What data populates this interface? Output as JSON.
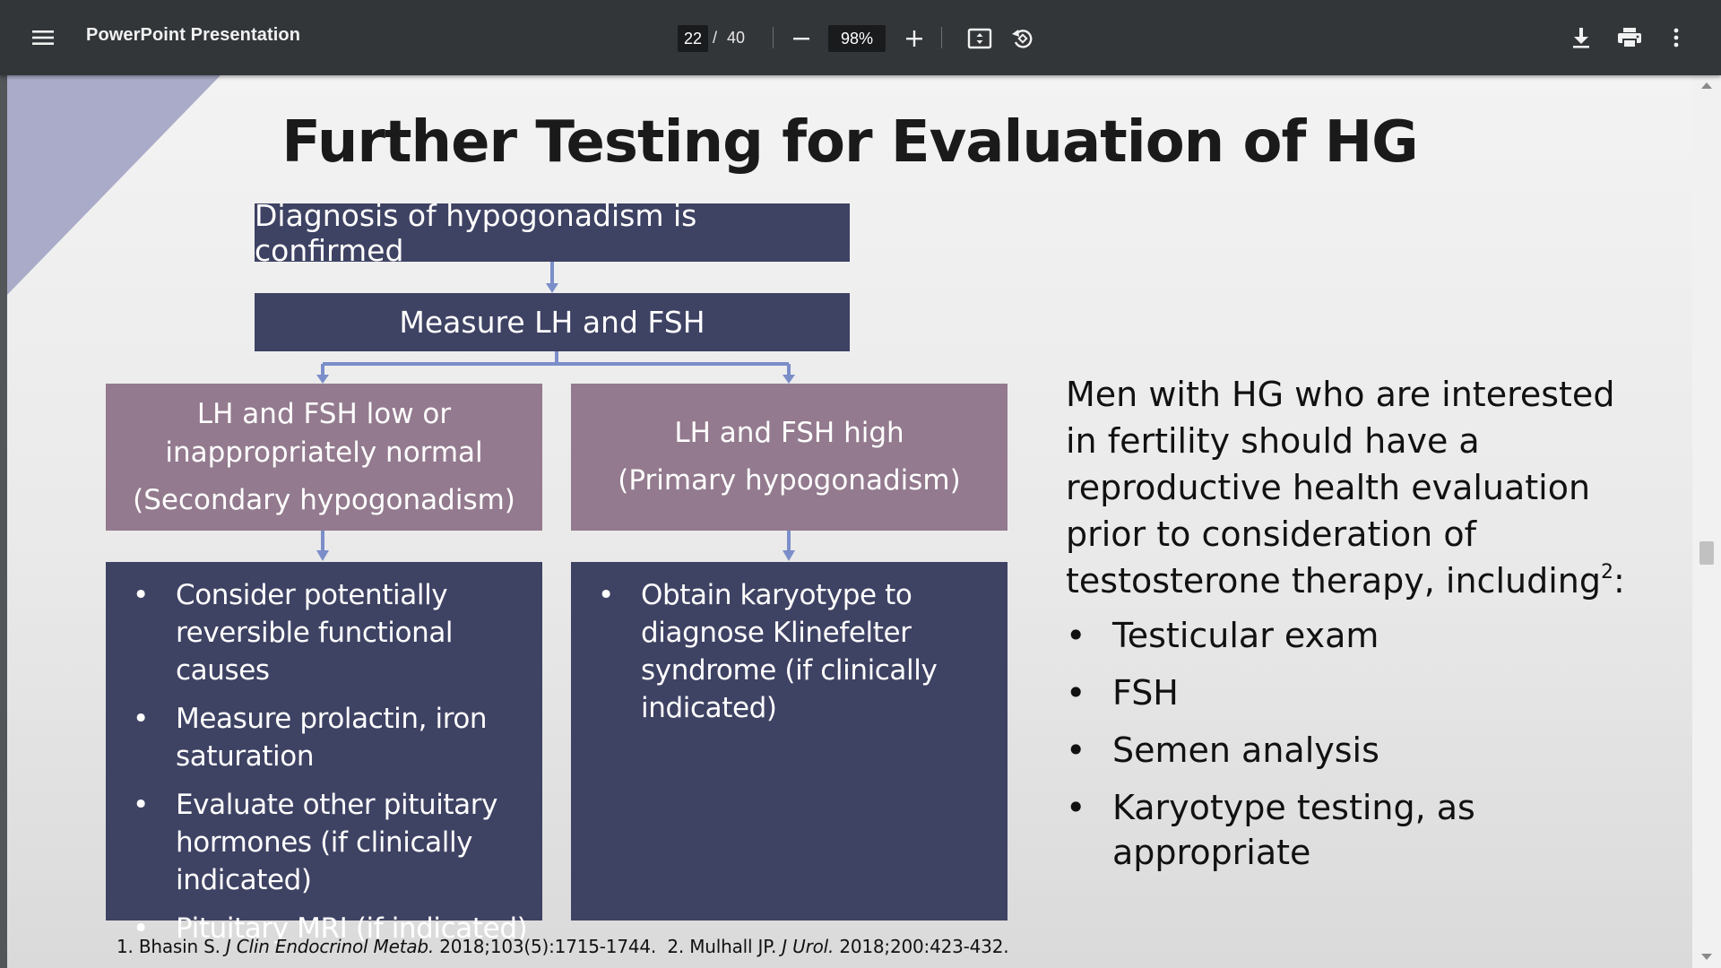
{
  "toolbar": {
    "menu_icon": "hamburger-menu-icon",
    "title": "PowerPoint Presentation",
    "current_page": "22",
    "page_separator": "/",
    "total_pages": "40",
    "zoom_out_icon": "minus-icon",
    "zoom_level": "98%",
    "zoom_in_icon": "plus-icon",
    "fit_icon": "fit-to-page-icon",
    "rotate_icon": "rotate-counterclockwise-icon",
    "download_icon": "download-icon",
    "print_icon": "print-icon",
    "more_icon": "more-vertical-icon"
  },
  "slide": {
    "title": "Further Testing for Evaluation of HG",
    "flow": {
      "top_box": "Diagnosis of hypogonadism is confirmed",
      "second_box": "Measure LH and FSH",
      "left_branch": {
        "line1": "LH and FSH low or",
        "line2": "inappropriately normal",
        "line3": "(Secondary hypogonadism)"
      },
      "right_branch": {
        "line1": "LH and FSH high",
        "line2": "(Primary hypogonadism)"
      },
      "left_actions": [
        "Consider potentially reversible functional causes",
        "Measure prolactin, iron saturation",
        "Evaluate other pituitary hormones (if clinically indicated)",
        "Pituitary MRI (if indicated)"
      ],
      "right_actions": [
        "Obtain karyotype to diagnose Klinefelter syndrome (if clinically indicated)"
      ]
    },
    "side_text": {
      "intro": "Men with HG who are interested in fertility should have a reproductive health evaluation prior to consideration of testosterone therapy, including",
      "superscript": "2",
      "colon": ":",
      "items": [
        "Testicular exam",
        "FSH",
        "Semen analysis",
        "Karyotype testing, as appropriate"
      ]
    },
    "references": {
      "ref1_num": "1. Bhasin S. ",
      "ref1_journal": "J Clin Endocrinol Metab.",
      "ref1_rest": " 2018;103(5):1715-1744.",
      "ref2_num": "  2. Mulhall JP. ",
      "ref2_journal": "J Urol.",
      "ref2_rest": " 2018;200:423-432."
    },
    "colors": {
      "dark_box": "#3e4263",
      "mauve_box": "#937a8e",
      "connector": "#7b8ec9",
      "corner": "#a9abc8"
    }
  }
}
